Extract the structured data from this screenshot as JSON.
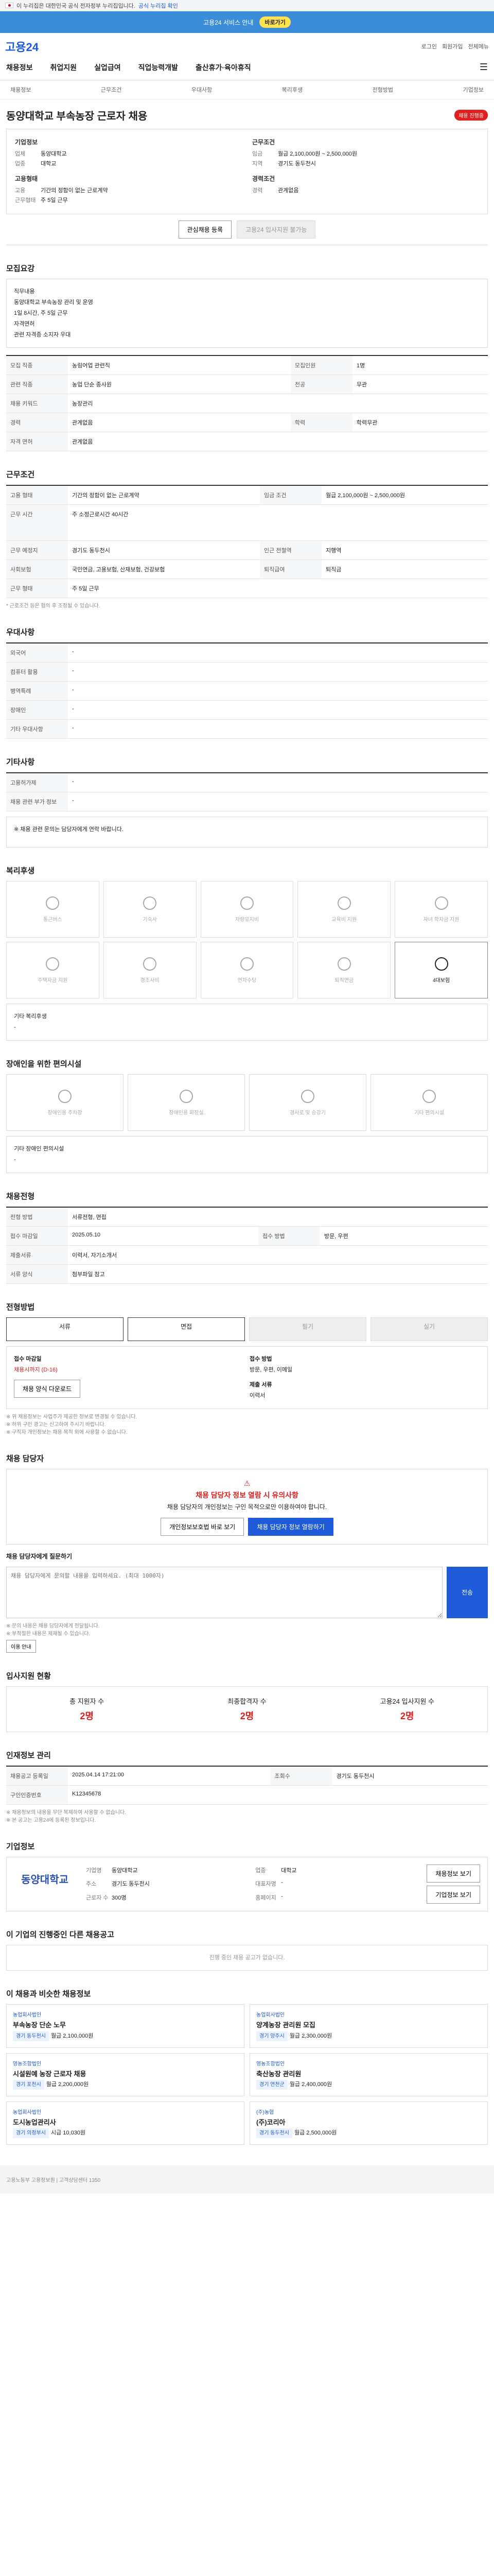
{
  "gov_banner": {
    "text": "이 누리집은 대한민국 공식 전자정부 누리집입니다.",
    "toggle": "공식 누리집 확인"
  },
  "event_banner": {
    "text": "고용24 서비스 안내",
    "cta": "바로가기"
  },
  "header": {
    "logo": "고용24",
    "util": [
      "로그인",
      "회원가입",
      "전체메뉴"
    ]
  },
  "gnb": [
    "채용정보",
    "취업지원",
    "실업급여",
    "직업능력개발",
    "출산휴가·육아휴직"
  ],
  "breadcrumb": [
    "채용정보",
    "근무조건",
    "우대사항",
    "복리후생",
    "전형방법",
    "기업정보"
  ],
  "job": {
    "title": "동양대학교 부속농장 근로자 채용",
    "badge": "채용 진행중",
    "company_head": "기업정보",
    "company": [
      [
        "업체",
        "동양대학교"
      ],
      [
        "업종",
        "대학교"
      ]
    ],
    "cond_head": "근무조건",
    "cond": [
      [
        "임금",
        "월급 2,100,000원 ~ 2,500,000원"
      ],
      [
        "지역",
        "경기도 동두천시"
      ]
    ],
    "type_head": "고용형태",
    "type": [
      [
        "고용",
        "기간의 정함이 없는 근로계약"
      ],
      [
        "근무형태",
        "주 5일 근무"
      ]
    ],
    "career_head": "경력조건",
    "career": [
      [
        "경력",
        "관계없음"
      ]
    ],
    "btn_interest": "관심채용 등록",
    "btn_apply": "고용24 입사지원 불가능"
  },
  "recruit": {
    "head": "모집요강",
    "intro_lines": [
      "직무내용",
      "동양대학교 부속농장 관리 및 운영",
      "1일 8시간, 주 5일 근무",
      "자격면허",
      "관련 자격증 소지자 우대"
    ],
    "rows": [
      [
        "모집 직종",
        "농림어업 관련직",
        "모집인원",
        "1명"
      ],
      [
        "관련 직종",
        "농업 단순 종사원",
        "전공",
        "무관"
      ],
      [
        "채용 키워드",
        "농장관리",
        "",
        ""
      ],
      [
        "경력",
        "관계없음",
        "학력",
        "학력무관"
      ],
      [
        "자격 면허",
        "관계없음",
        "",
        ""
      ]
    ]
  },
  "work": {
    "head": "근무조건",
    "rows": [
      [
        "고용 형태",
        "기간의 정함이 없는 근로계약",
        "임금 조건",
        "월급 2,100,000원 ~ 2,500,000원"
      ],
      [
        "근무 시간",
        "주 소정근로시간 40시간",
        "",
        ""
      ],
      [
        "근무 예정지",
        "경기도 동두천시",
        "인근 전철역",
        "지행역"
      ],
      [
        "사회보험",
        "국민연금, 고용보험, 산재보험, 건강보험",
        "퇴직급여",
        "퇴직금"
      ],
      [
        "근무 형태",
        "주 5일 근무",
        "",
        ""
      ]
    ],
    "note": "* 근로조건 등은 협의 후 조정될 수 있습니다."
  },
  "pref": {
    "head": "우대사항",
    "rows": [
      [
        "외국어",
        "-"
      ],
      [
        "컴퓨터 활용",
        "-"
      ],
      [
        "병역특례",
        "-"
      ],
      [
        "장애인",
        "-"
      ],
      [
        "기타 우대사항",
        "-"
      ]
    ]
  },
  "etc": {
    "head": "기타사항",
    "rows": [
      [
        "고용허가제",
        "-"
      ],
      [
        "채용 관련 부가 정보",
        "-"
      ]
    ],
    "box": "※ 채용 관련 문의는 담당자에게 연락 바랍니다."
  },
  "welfare": {
    "head": "복리후생",
    "items": [
      "통근버스",
      "기숙사",
      "차량유지비",
      "교육비 지원",
      "자녀 학자금 지원",
      "주택자금 지원",
      "경조사비",
      "연차수당",
      "퇴직연금",
      "4대보험"
    ],
    "on": [
      9
    ],
    "other_head": "기타 복리후생",
    "other": "-"
  },
  "disability": {
    "head": "장애인을 위한 편의시설",
    "items": [
      "장애인용 주차장",
      "장애인용 화장실",
      "경사로 및 승강기",
      "기타 편의시설"
    ],
    "other_head": "기타 장애인 편의시설",
    "other": "-"
  },
  "process": {
    "head": "채용전형",
    "rows": [
      [
        "전형 방법",
        "서류전형, 면접"
      ],
      [
        "접수 마감일",
        "2025.05.10",
        "접수 방법",
        "방문, 우편"
      ],
      [
        "제출서류",
        "이력서, 자기소개서",
        "",
        ""
      ],
      [
        "서류 양식",
        "첨부파일 참고",
        "",
        ""
      ]
    ]
  },
  "method": {
    "head": "전형방법",
    "options": [
      "서류",
      "면접",
      "필기",
      "실기"
    ],
    "on": [
      0,
      1
    ],
    "period_head": "접수 마감일",
    "period": "채용시까지 (D-16)",
    "how_head": "접수 방법",
    "how": [
      "방문, 우편, 이메일"
    ],
    "btn": "채용 양식 다운로드",
    "docs_head": "제출 서류",
    "docs": "이력서",
    "notes": [
      "※ 위 채용정보는 사업주가 제공한 정보로 변경될 수 있습니다.",
      "※ 허위 구인 광고는 신고하여 주시기 바랍니다.",
      "※ 구직자 개인정보는 채용 목적 외에 사용할 수 없습니다."
    ]
  },
  "contact": {
    "head": "채용 담당자",
    "alert_title": "채용 담당자 정보 열람 시 유의사항",
    "alert_body": "채용 담당자의 개인정보는 구인 목적으로만 이용하여야 합니다.",
    "btn_view": "채용 담당자 정보 열람하기",
    "btn_report": "개인정보보호법 바로 보기",
    "inquiry_head": "채용 담당자에게 질문하기",
    "inquiry_placeholder": "채용 담당자에게 문의할 내용을 입력하세요. (최대 1000자)",
    "inquiry_btn": "전송",
    "notes": [
      "※ 문의 내용은 채용 담당자에게 전달됩니다.",
      "※ 부적절한 내용은 제재될 수 있습니다."
    ],
    "notes_btn": "이용 안내"
  },
  "stats": {
    "head": "입사지원 현황",
    "items": [
      [
        "총 지원자 수",
        "2명"
      ],
      [
        "최종합격자 수",
        "2명"
      ],
      [
        "고용24 입사지원 수",
        "2명"
      ]
    ]
  },
  "recruit_info": {
    "head": "인재정보 관리",
    "rows": [
      [
        "채용공고 등록일",
        "2025.04.14 17:21:00",
        "조회수",
        "경기도 동두천시"
      ],
      [
        "구인인증번호",
        "K12345678",
        "",
        ""
      ]
    ],
    "notes": [
      "※ 채용정보의 내용을 무단 복제하여 사용할 수 없습니다.",
      "※ 본 공고는 고용24에 등록된 정보입니다."
    ]
  },
  "company_info": {
    "head": "기업정보",
    "logo": "동양대학교",
    "logo_sub": "DONGYANG UNIVERSITY",
    "rows": [
      [
        "기업명",
        "동양대학교"
      ],
      [
        "업종",
        "대학교"
      ],
      [
        "주소",
        "경기도 동두천시"
      ],
      [
        "대표자명",
        "-"
      ],
      [
        "근로자 수",
        "300명"
      ],
      [
        "홈페이지",
        "-"
      ]
    ],
    "btn_list": "채용정보 보기",
    "btn_info": "기업정보 보기"
  },
  "same_co": {
    "head": "이 기업의 진행중인 다른 채용공고",
    "empty": "진행 중인 채용 공고가 없습니다."
  },
  "recommend": {
    "head": "이 채용과 비슷한 채용정보",
    "cards": [
      {
        "co": "농업회사법인",
        "title": "부속농장 단순 노무",
        "loc": "경기 동두천시",
        "pay": "월급 2,100,000원"
      },
      {
        "co": "농업회사법인",
        "title": "양계농장 관리원 모집",
        "loc": "경기 양주시",
        "pay": "월급 2,300,000원"
      },
      {
        "co": "영농조합법인",
        "title": "시설원예 농장 근로자 채용",
        "loc": "경기 포천시",
        "pay": "월급 2,200,000원"
      },
      {
        "co": "영농조합법인",
        "title": "축산농장 관리원",
        "loc": "경기 연천군",
        "pay": "월급 2,400,000원"
      },
      {
        "co": "농업회사법인",
        "title": "도시농업관리사",
        "loc": "경기 의정부시",
        "pay": "시급 10,030원"
      },
      {
        "co": "(주)농협",
        "title": "(주)코리아",
        "loc": "경기 동두천시",
        "pay": "월급 2,500,000원"
      }
    ]
  },
  "footer": {
    "text": "고용노동부 고용정보원 | 고객상담센터 1350"
  }
}
